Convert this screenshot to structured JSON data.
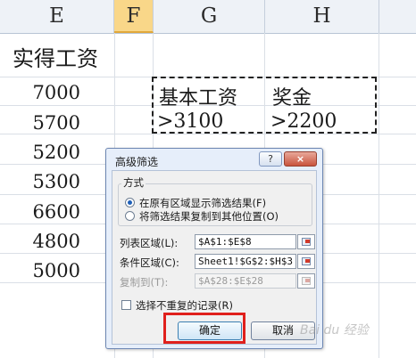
{
  "columns": [
    "E",
    "F",
    "G",
    "H"
  ],
  "header_cell": "实得工资",
  "values": [
    "7000",
    "5700",
    "5200",
    "5300",
    "6600",
    "4800",
    "5000"
  ],
  "criteria": {
    "headers": [
      "基本工资",
      "奖金"
    ],
    "conditions": [
      ">3100",
      ">2200"
    ]
  },
  "dialog": {
    "title": "高级筛选",
    "help_label": "?",
    "close_label": "×",
    "group_label": "方式",
    "radio_in_place": "在原有区域显示筛选结果(F)",
    "radio_copy": "将筛选结果复制到其他位置(O)",
    "list_range_label": "列表区域(L):",
    "list_range_value": "$A$1:$E$8",
    "criteria_range_label": "条件区域(C):",
    "criteria_range_value": "Sheet1!$G$2:$H$3",
    "copy_to_label": "复制到(T):",
    "copy_to_value": "$A$28:$E$28",
    "unique_label": "选择不重复的记录(R)",
    "ok_label": "确定",
    "cancel_label": "取消",
    "selected_radio": "in_place",
    "unique_checked": false
  },
  "watermark": "Bai du 经验",
  "colors": {
    "active_column": "#f9d789",
    "highlight": "#e0201c",
    "dialog_frame": "#e6eefa"
  }
}
